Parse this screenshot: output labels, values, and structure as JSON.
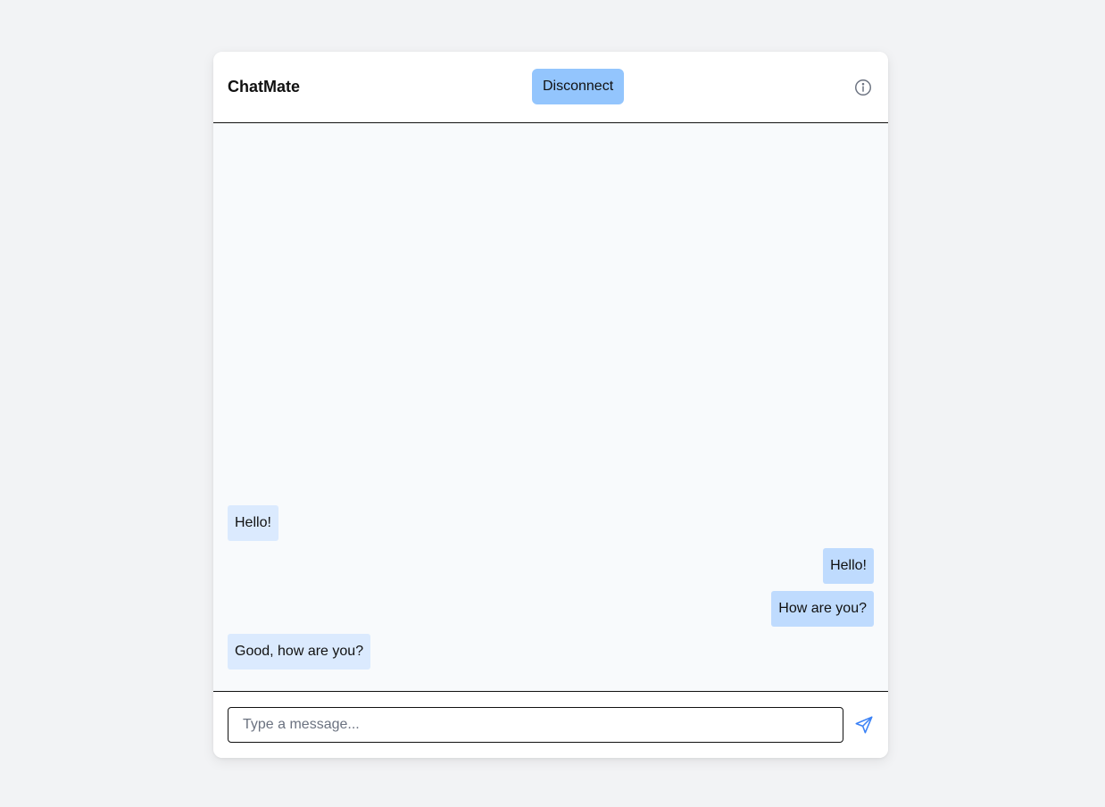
{
  "header": {
    "title": "ChatMate",
    "disconnect_label": "Disconnect",
    "info_icon": "info-circle-icon"
  },
  "messages": [
    {
      "direction": "incoming",
      "text": "Hello!"
    },
    {
      "direction": "outgoing",
      "text": "Hello!"
    },
    {
      "direction": "outgoing",
      "text": "How are you?"
    },
    {
      "direction": "incoming",
      "text": "Good, how are you?"
    }
  ],
  "composer": {
    "value": "",
    "placeholder": "Type a message...",
    "send_icon": "send-icon"
  },
  "colors": {
    "accent": "#93c5fd",
    "incoming_bubble": "#dbeafe",
    "outgoing_bubble": "#bfdbfe",
    "send_icon": "#3b82f6"
  }
}
